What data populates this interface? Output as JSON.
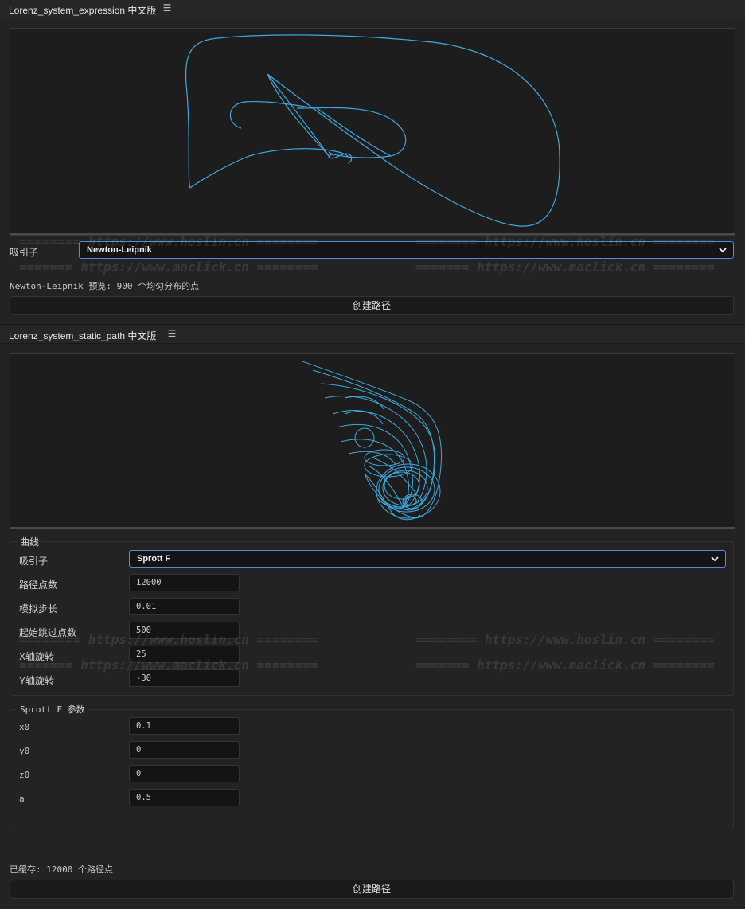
{
  "panel1": {
    "title": "Lorenz_system_expression 中文版",
    "attractor_label": "吸引子",
    "attractor_value": "Newton-Leipnik",
    "preview_text": "Newton-Leipnik 预览: 900 个均匀分布的点",
    "create_button": "创建路径"
  },
  "panel2": {
    "title": "Lorenz_system_static_path 中文版",
    "curve_group": {
      "title": "曲线",
      "attractor_label": "吸引子",
      "attractor_value": "Sprott F",
      "fields": [
        {
          "label": "路径点数",
          "value": "12000"
        },
        {
          "label": "模拟步长",
          "value": "0.01"
        },
        {
          "label": "起始跳过点数",
          "value": "500"
        },
        {
          "label": "X轴旋转",
          "value": "25"
        },
        {
          "label": "Y轴旋转",
          "value": "-30"
        }
      ]
    },
    "params_group": {
      "title": "Sprott F 参数",
      "fields": [
        {
          "label": "x0",
          "value": "0.1"
        },
        {
          "label": "y0",
          "value": "0"
        },
        {
          "label": "z0",
          "value": "0"
        },
        {
          "label": "a",
          "value": "0.5"
        }
      ]
    },
    "cache_text": "已缓存: 12000 个路径点",
    "create_button": "创建路径"
  },
  "watermarks": {
    "hoslin": "======== https://www.hoslin.cn ========",
    "maclick": "======= https://www.maclick.cn ========"
  },
  "colors": {
    "curve": "#3fa9df",
    "accent_border": "#4a90e2",
    "background": "#232323"
  },
  "icons": {
    "menu": "hamburger-menu-icon",
    "dropdown": "chevron-down-icon"
  }
}
